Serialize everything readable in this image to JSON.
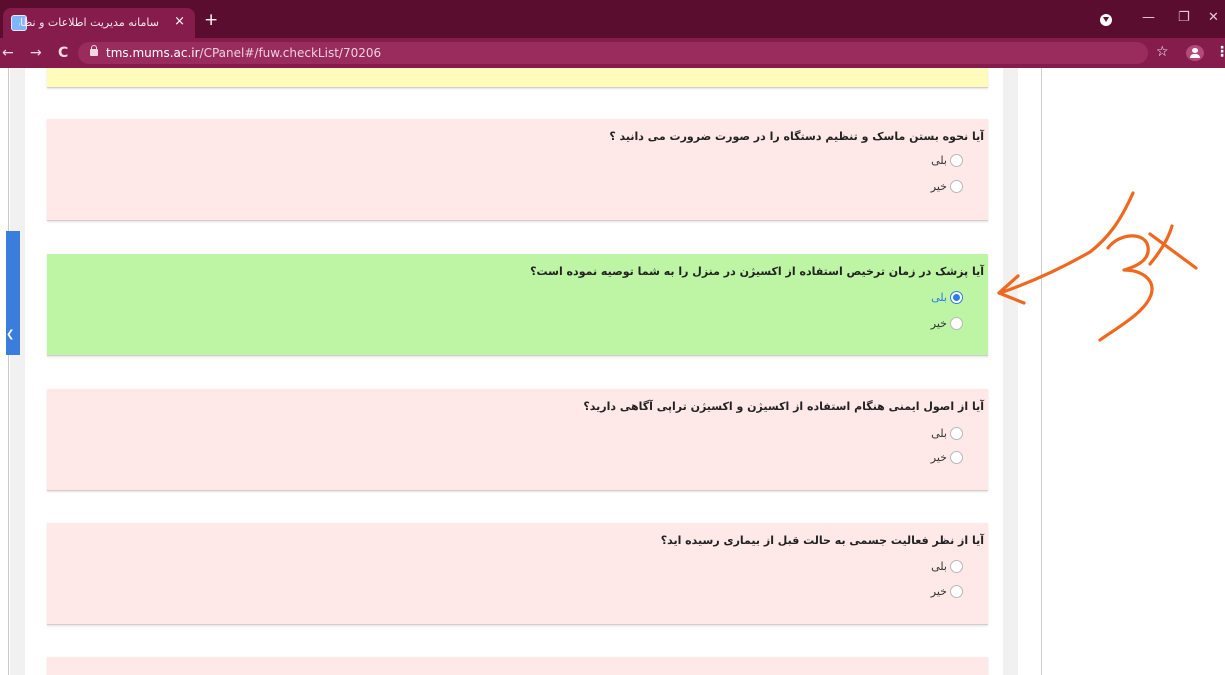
{
  "browser": {
    "tab_title": "سامانه مدیریت اطلاعات و نظارت",
    "tab_close": "×",
    "new_tab": "+",
    "url_host": "tms.mums.ac.ir",
    "url_path": "/CPanel#/fuw.checkList/70206",
    "back": "←",
    "forward": "→",
    "reload": "C",
    "star": "☆",
    "menu": "⋮",
    "min": "—",
    "max": "❐",
    "close": "✕"
  },
  "questions": [
    {
      "text": "آیا نحوه بستن ماسک و تنظیم دستگاه را در صورت ضرورت می دانید ؟",
      "options": [
        {
          "label": "بلی",
          "checked": false
        },
        {
          "label": "خیر",
          "checked": false
        }
      ]
    },
    {
      "text": "آیا پزشک در زمان ترخیص استفاده از اکسیژن در منزل را به شما توصیه نموده است؟",
      "options": [
        {
          "label": "بلی",
          "checked": true
        },
        {
          "label": "خیر",
          "checked": false
        }
      ]
    },
    {
      "text": "آیا از اصول ایمنی هنگام استفاده از اکسیژن و اکسیژن تراپی آگاهی دارید؟",
      "options": [
        {
          "label": "بلی",
          "checked": false
        },
        {
          "label": "خیر",
          "checked": false
        }
      ]
    },
    {
      "text": "آیا از نظر فعالیت جسمی به حالت قبل از بیماری رسیده اید؟",
      "options": [
        {
          "label": "بلی",
          "checked": false
        },
        {
          "label": "خیر",
          "checked": false
        }
      ]
    }
  ],
  "colors": {
    "tabbar": "#5b0d2f",
    "toolbar": "#861c4b",
    "card_pink": "#ffe8e8",
    "card_green": "#bdf5a4",
    "card_yellow": "#fffbbd",
    "radio_selected": "#2d7be5",
    "annotation_ink": "#f0671e"
  },
  "icons": {
    "favicon": "site-favicon-icon",
    "lock": "lock-icon",
    "star": "bookmark-star-icon",
    "account": "account-icon",
    "collapse": "chevron-left-icon"
  }
}
